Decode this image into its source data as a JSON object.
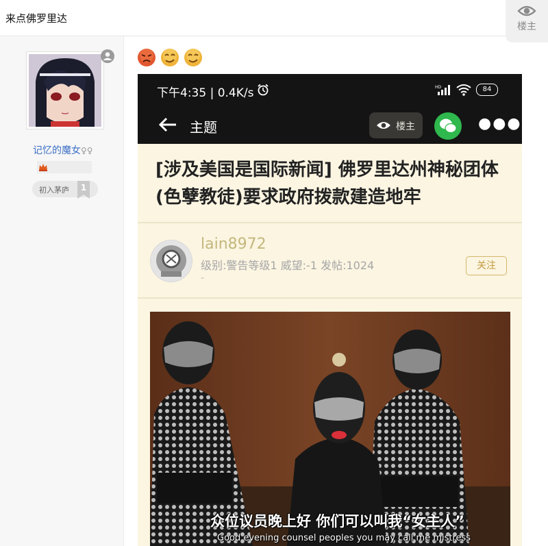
{
  "thread": {
    "title": "来点佛罗里达"
  },
  "louzhu_button": {
    "label": "楼主",
    "icon": "eye-icon"
  },
  "author": {
    "name": "记忆的魔女",
    "gender_symbol": "♀",
    "rank_label": "初入茅庐",
    "rank_level": "1"
  },
  "emojis": [
    "angry-face-icon",
    "smirk-face-icon",
    "smirk-face-icon"
  ],
  "screenshot": {
    "status_time": "下午4:35 | 0.4K/s",
    "battery": "84",
    "nav_title": "主题",
    "nav_louzhu": "楼主",
    "post_title": "[涉及美国是国际新闻] 佛罗里达州神秘团体(色孽教徒)要求政府拨款建造地牢",
    "poster_name": "lain8972",
    "poster_meta": "级别:警告等级1 威望:-1 发帖:1024",
    "poster_dash": "-",
    "follow_label": "关注",
    "subtitle_cn": "众位议员晚上好 你们可以叫我“女主人”",
    "subtitle_en": "Good evening counsel peoples you may call me mistress"
  },
  "colors": {
    "username": "#3b6fc4",
    "accent_gold": "#c49a3c",
    "wechat_green": "#2fb84d"
  }
}
